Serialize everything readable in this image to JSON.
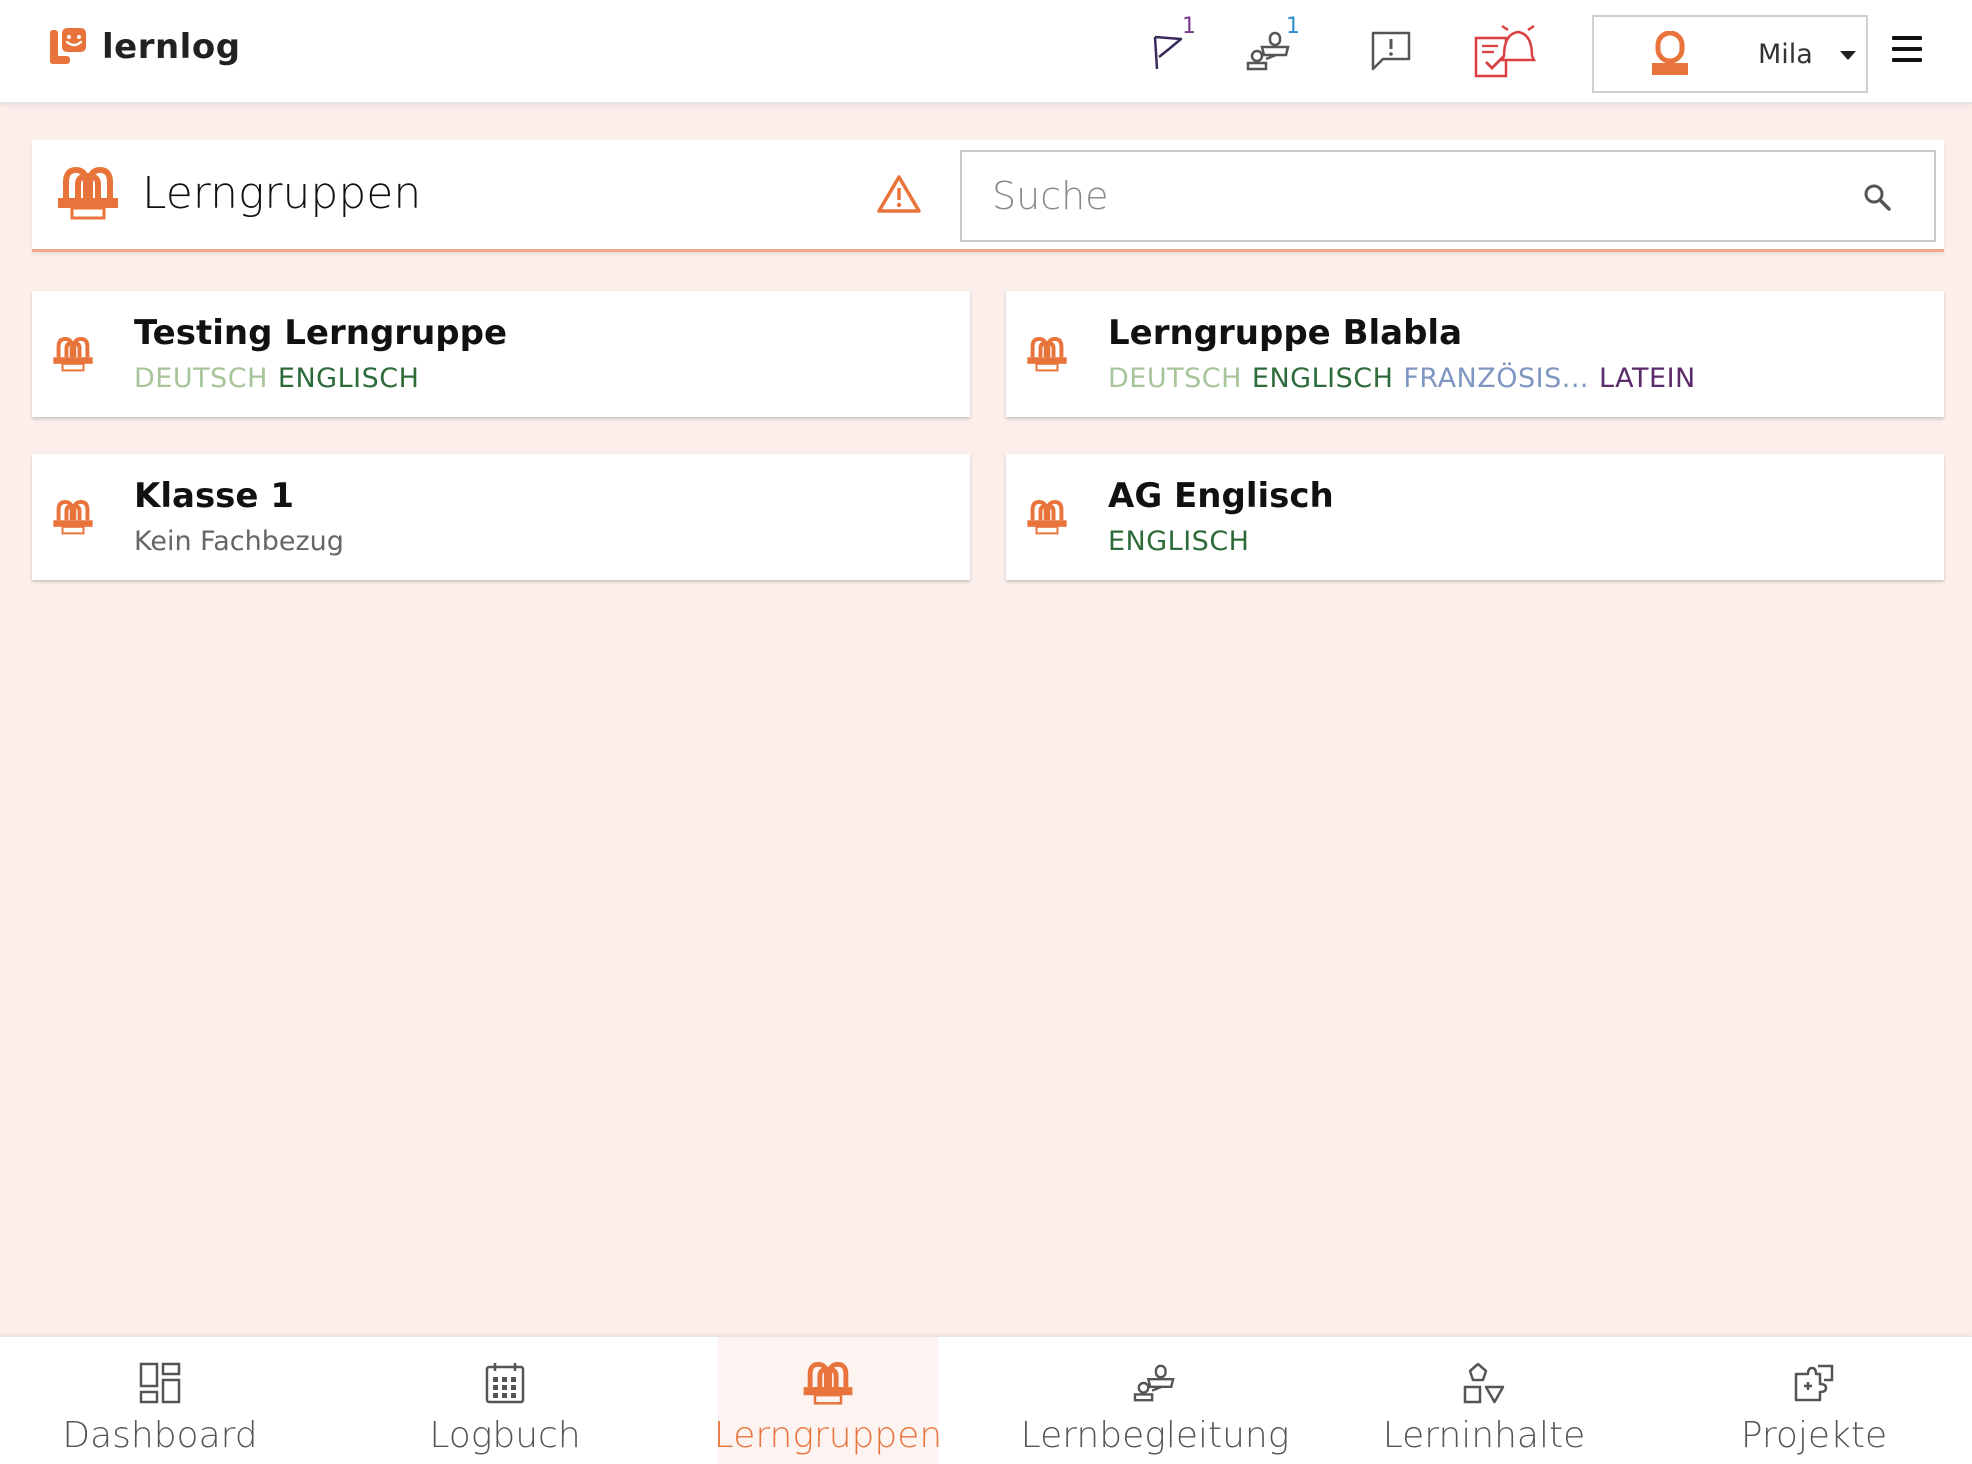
{
  "app": {
    "name": "lernlog",
    "brand_color": "#e8743b"
  },
  "header": {
    "icons": [
      {
        "name": "flag-icon",
        "badge": "1",
        "badge_color": "#7a3a8c"
      },
      {
        "name": "mentoring-icon",
        "badge": "1",
        "badge_color": "#2d8fd0"
      },
      {
        "name": "feedback-icon",
        "badge": ""
      },
      {
        "name": "alarm-checklist-icon",
        "badge": ""
      }
    ],
    "user": {
      "name": "Mila"
    }
  },
  "page": {
    "title": "Lerngruppen",
    "search": {
      "placeholder": "Suche",
      "value": ""
    }
  },
  "groups": [
    {
      "name": "Testing Lerngruppe",
      "subjects": [
        {
          "label": "DEUTSCH",
          "color": "#a8c49a"
        },
        {
          "label": "ENGLISCH",
          "color": "#2e6b3a"
        }
      ]
    },
    {
      "name": "Lerngruppe Blabla",
      "subjects": [
        {
          "label": "DEUTSCH",
          "color": "#a8c49a"
        },
        {
          "label": "ENGLISCH",
          "color": "#2e6b3a"
        },
        {
          "label": "FRANZÖSIS...",
          "color": "#7f96c2"
        },
        {
          "label": "LATEIN",
          "color": "#5a2a6a"
        }
      ]
    },
    {
      "name": "Klasse 1",
      "no_subject": "Kein Fachbezug",
      "subjects": []
    },
    {
      "name": "AG Englisch",
      "subjects": [
        {
          "label": "ENGLISCH",
          "color": "#2e6b3a"
        }
      ]
    }
  ],
  "bottom_nav": [
    {
      "label": "Dashboard",
      "icon": "dashboard-icon",
      "active": false
    },
    {
      "label": "Logbuch",
      "icon": "calendar-icon",
      "active": false
    },
    {
      "label": "Lerngruppen",
      "icon": "group-icon",
      "active": true
    },
    {
      "label": "Lernbegleitung",
      "icon": "mentoring-icon",
      "active": false
    },
    {
      "label": "Lerninhalte",
      "icon": "shapes-icon",
      "active": false
    },
    {
      "label": "Projekte",
      "icon": "puzzle-icon",
      "active": false
    }
  ]
}
